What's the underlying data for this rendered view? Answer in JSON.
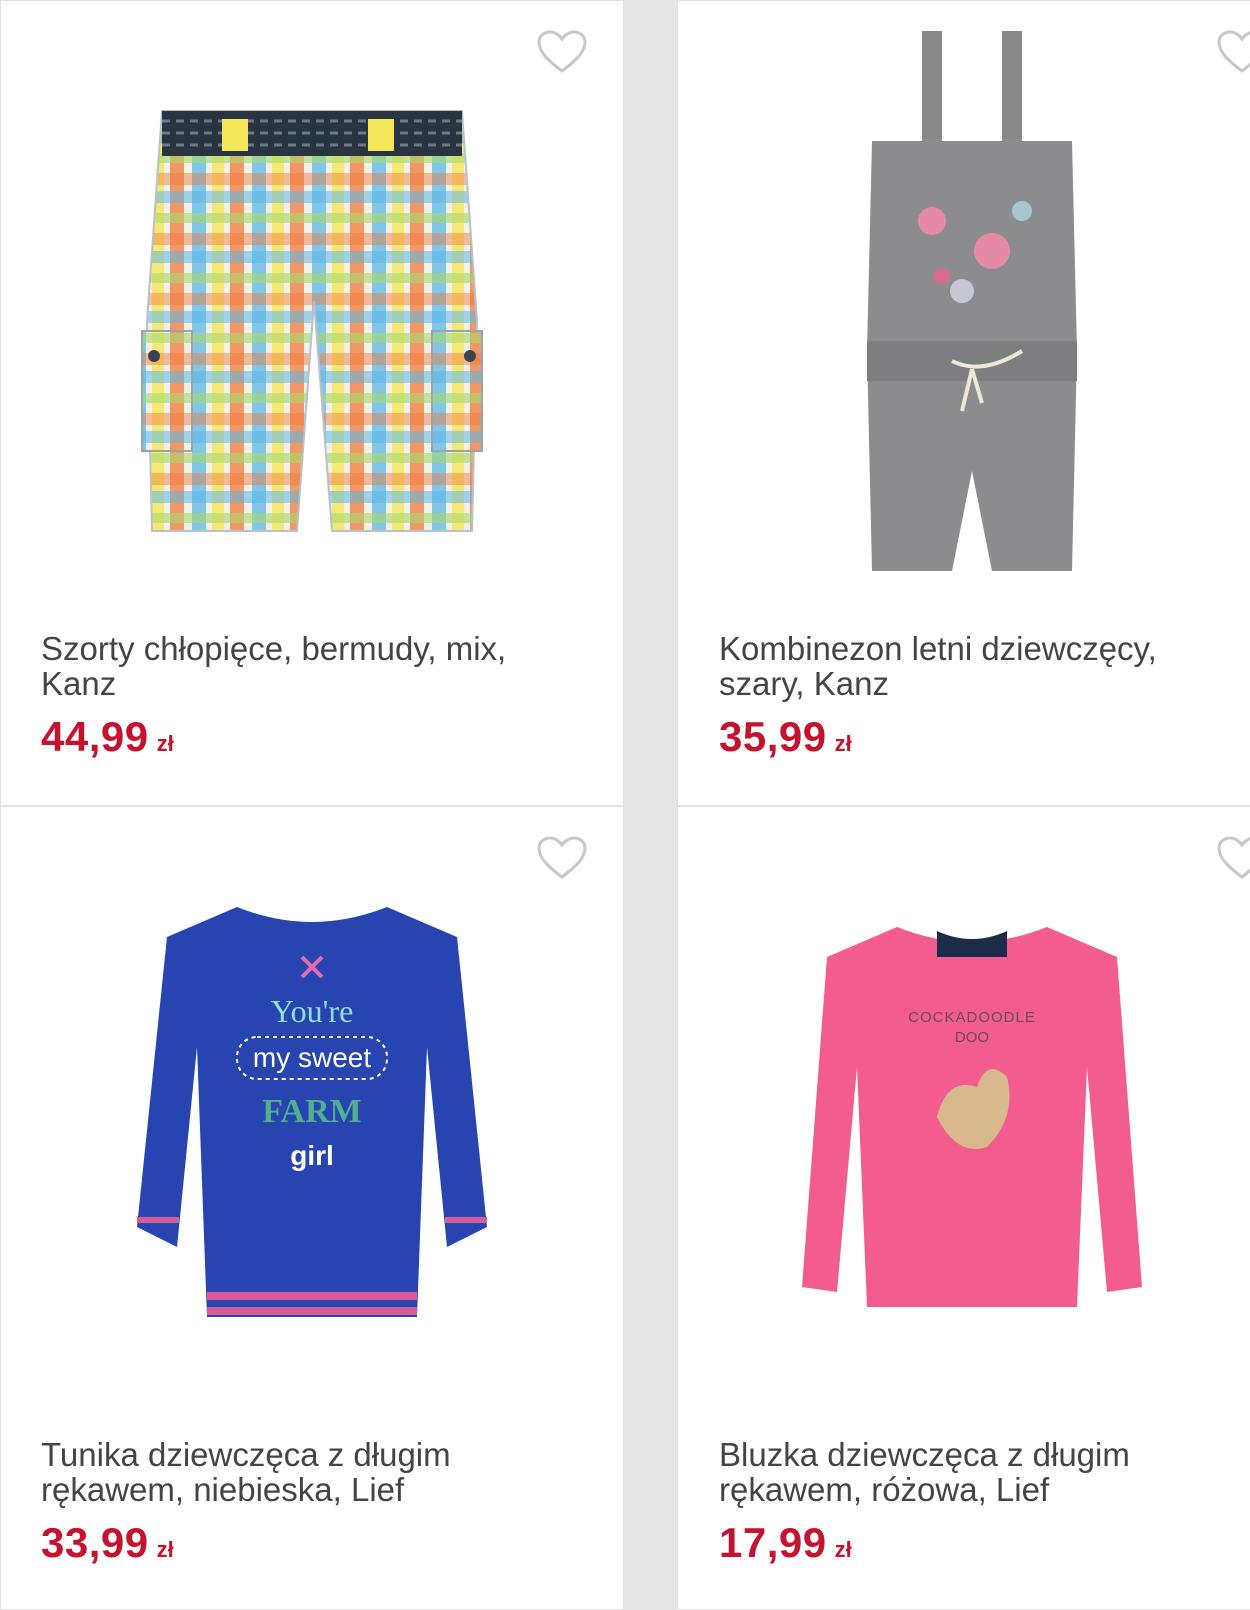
{
  "accent_color": "#c4122f",
  "products": [
    {
      "title": "Szorty chłopięce, bermudy, mix, Kanz",
      "price": "44,99",
      "currency": "zł",
      "image_icon": "checkered-shorts-image"
    },
    {
      "title": "Kombinezon letni dziewczęcy, szary, Kanz",
      "price": "35,99",
      "currency": "zł",
      "image_icon": "grey-jumpsuit-image"
    },
    {
      "title": "Tunika dziewczęca z długim rękawem, niebieska, Lief",
      "price": "33,99",
      "currency": "zł",
      "image_icon": "blue-tunic-image",
      "print_lines": [
        "You're",
        "my sweet",
        "FARM",
        "girl"
      ]
    },
    {
      "title": "Bluzka dziewczęca z długim rękawem, różowa, Lief",
      "price": "17,99",
      "currency": "zł",
      "image_icon": "pink-blouse-image",
      "print_lines": [
        "COCKADOODLE",
        "DOO"
      ]
    }
  ]
}
